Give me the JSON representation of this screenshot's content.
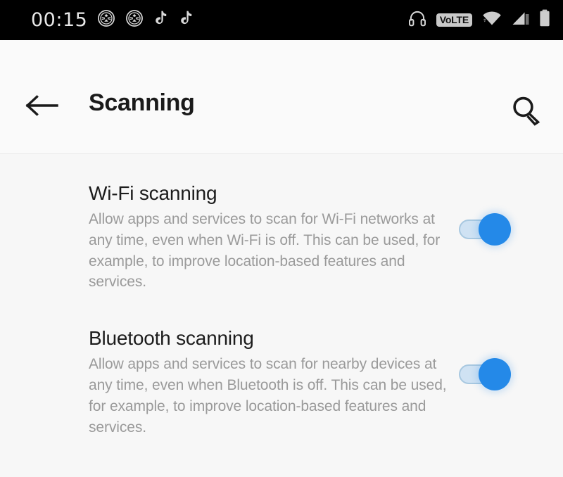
{
  "status_bar": {
    "clock": "00:15",
    "background_color": "#000000",
    "left_icons": [
      {
        "name": "shield-notification-icon",
        "label": "shield"
      },
      {
        "name": "shield-notification-icon",
        "label": "shield"
      },
      {
        "name": "tiktok-notification-icon",
        "label": "tiktok"
      },
      {
        "name": "tiktok-notification-icon",
        "label": "tiktok"
      }
    ],
    "right_icons": [
      {
        "name": "headphones-icon",
        "label": "headphones"
      },
      {
        "name": "volte-icon",
        "label": "VoLTE"
      },
      {
        "name": "wifi-icon",
        "label": "wifi"
      },
      {
        "name": "cellular-signal-icon",
        "label": "signal"
      },
      {
        "name": "battery-icon",
        "label": "battery"
      }
    ],
    "volte_label": "VoLTE"
  },
  "toolbar": {
    "title": "Scanning",
    "back_icon": "arrow-left-icon",
    "search_icon": "search-icon",
    "background_color": "#fafafa"
  },
  "theme": {
    "page_background": "#f7f7f7",
    "accent_color": "#2489e8",
    "track_color": "#cfe2f3",
    "title_color": "#1c1c1c",
    "description_color": "#9a9a9a"
  },
  "settings": [
    {
      "id": "wifi-scanning",
      "title": "Wi-Fi scanning",
      "description": "Allow apps and services to scan for Wi-Fi networks at any time, even when Wi-Fi is off. This can be used, for example, to improve location-based features and services.",
      "toggle_state": "on"
    },
    {
      "id": "bluetooth-scanning",
      "title": "Bluetooth scanning",
      "description": "Allow apps and services to scan for nearby devices at any time, even when Bluetooth is off. This can be used, for example, to improve location-based features and services.",
      "toggle_state": "on"
    }
  ]
}
